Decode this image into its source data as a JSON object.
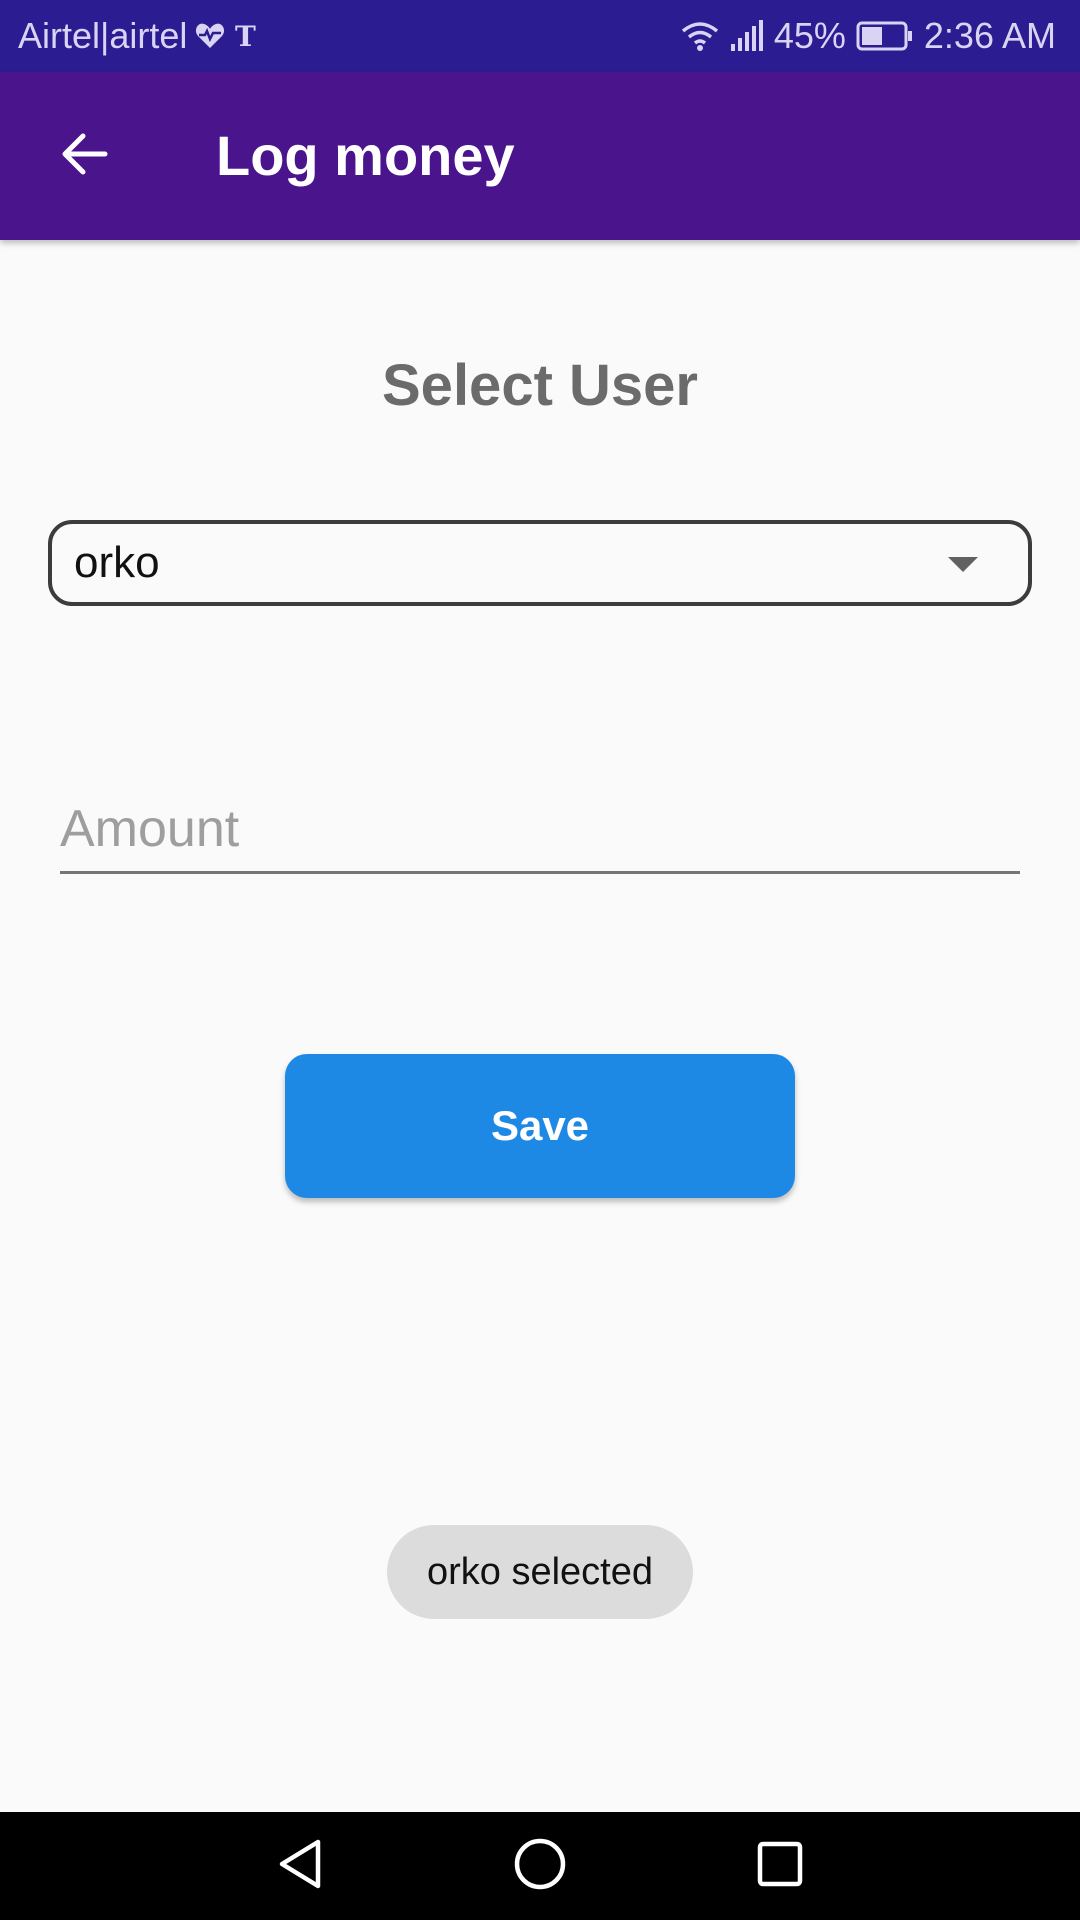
{
  "status_bar": {
    "carrier": "Airtel|airtel",
    "battery": "45%",
    "time": "2:36 AM",
    "icons": [
      "heart-pulse-icon",
      "nyt-icon",
      "wifi-icon",
      "signal-icon",
      "battery-icon"
    ]
  },
  "app_bar": {
    "title": "Log money",
    "back_icon": "arrow-left-icon"
  },
  "form": {
    "section_title": "Select User",
    "user_dropdown": {
      "selected": "orko"
    },
    "amount": {
      "value": "",
      "placeholder": "Amount"
    },
    "save_label": "Save"
  },
  "toast": {
    "message": "orko selected"
  },
  "nav_bar": {
    "icons": [
      "back-triangle-icon",
      "home-circle-icon",
      "recents-square-icon"
    ]
  },
  "colors": {
    "status_bar": "#2c1c91",
    "app_bar": "#4a148c",
    "primary_button": "#1e88e5",
    "background": "#fafafa"
  }
}
